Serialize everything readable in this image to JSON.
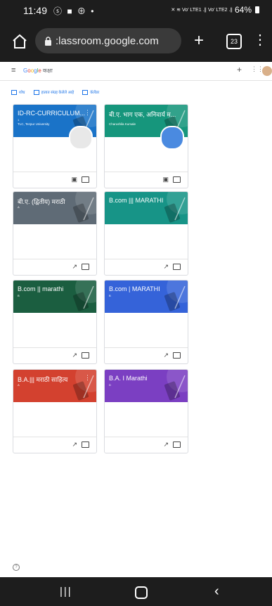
{
  "status": {
    "time": "11:49",
    "battery": "64%",
    "left_icons": "ⓢ ■ ⊕ •",
    "right_icons": "✕ ≋ Vo’ LTE1 .∥ Vo’ LTE2 .∥"
  },
  "browser": {
    "url": ":lassroom.google.com",
    "tab_count": "23"
  },
  "app": {
    "logo_parts": [
      "G",
      "o",
      "o",
      "g",
      "l",
      "e"
    ],
    "product": "कक्षा"
  },
  "subnav": [
    {
      "label": "शोध"
    },
    {
      "label": "हातात संग्रह केलेले आहे"
    },
    {
      "label": "कॅलेंडर"
    }
  ],
  "classes": [
    {
      "title": "ID-RC-CURRICULUM...",
      "section": "1",
      "subtitle": "TLC, Tezpur University",
      "color": "#1a73c8",
      "footer": "person-folder",
      "photo": true,
      "kebab": true
    },
    {
      "title": "बी.ए. भाग एक, अनिवार्य म...",
      "section": "",
      "subtitle": "Charushila Kumale",
      "color": "#16967c",
      "footer": "person-folder",
      "photo": true,
      "kebab": false
    },
    {
      "title": "बी.ए. (द्वितीय) मराठी",
      "section": "A",
      "subtitle": "",
      "color": "#5f6b76",
      "footer": "trend-folder",
      "photo": false,
      "kebab": false
    },
    {
      "title": "B.com ||| MARATHI",
      "section": "",
      "subtitle": "",
      "color": "#179487",
      "footer": "trend-folder",
      "photo": false,
      "kebab": false
    },
    {
      "title": "B.com || marathi",
      "section": "B",
      "subtitle": "",
      "color": "#1b5e40",
      "footer": "trend-folder",
      "photo": false,
      "kebab": false
    },
    {
      "title": "B.com | MARATHI",
      "section": "B",
      "subtitle": "",
      "color": "#3563d9",
      "footer": "trend-folder",
      "photo": false,
      "kebab": false
    },
    {
      "title": "B.A.||| मराठी साहित्य",
      "section": "A",
      "subtitle": "",
      "color": "#d3412f",
      "footer": "trend-folder",
      "photo": false,
      "kebab": true
    },
    {
      "title": "B.A. I Marathi",
      "section": "D",
      "subtitle": "",
      "color": "#7b3fc2",
      "footer": "trend-folder",
      "photo": false,
      "kebab": false
    }
  ]
}
